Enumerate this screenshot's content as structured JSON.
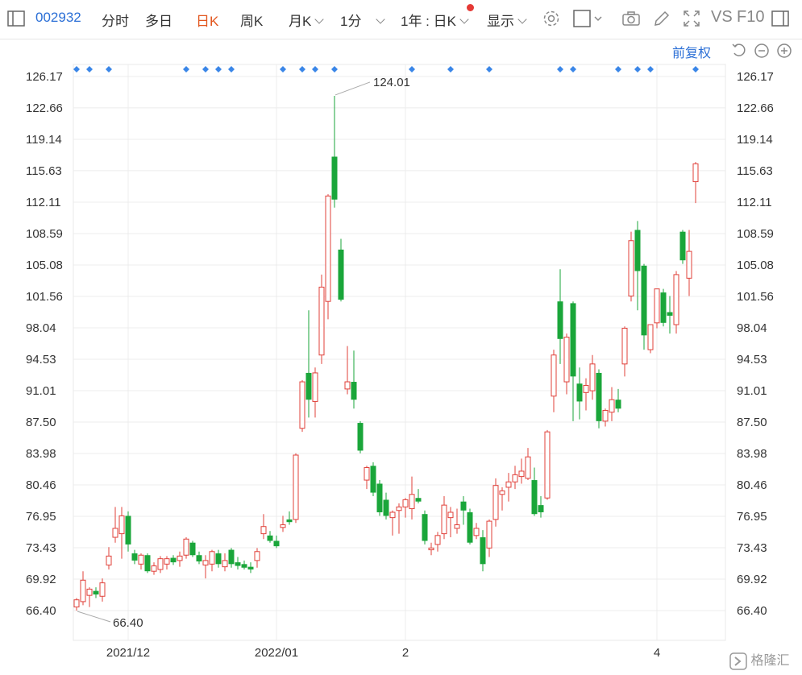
{
  "toolbar": {
    "code": "002932",
    "tabs": [
      "分时",
      "多日",
      "日K",
      "周K",
      "月K",
      "1分",
      "1年 : 日K",
      "显示"
    ],
    "active_tab": "日K",
    "vs_label": "VS",
    "f10_label": "F10",
    "adjust_label": "前复权"
  },
  "colors": {
    "up": "#e0403a",
    "down": "#1aa63a",
    "marker": "#3a86e8",
    "accent": "#2b6fd6"
  },
  "watermark": "格隆汇",
  "chart_data": {
    "type": "candlestick",
    "y_ticks": [
      "126.17",
      "122.66",
      "119.14",
      "115.63",
      "112.11",
      "108.59",
      "105.08",
      "101.56",
      "98.04",
      "94.53",
      "91.01",
      "87.50",
      "83.98",
      "80.46",
      "76.95",
      "73.43",
      "69.92",
      "66.40"
    ],
    "ylim": [
      66.4,
      126.17
    ],
    "x_labels": [
      {
        "label": "2021/12",
        "index": 8
      },
      {
        "label": "2022/01",
        "index": 31
      },
      {
        "label": "2",
        "index": 51
      },
      {
        "label": "4",
        "index": 90
      }
    ],
    "annotations": [
      {
        "label": "124.01",
        "index": 40,
        "value": 124.01
      },
      {
        "label": "66.40",
        "index": 0,
        "value": 66.4
      }
    ],
    "marker_indices": [
      0,
      2,
      5,
      17,
      20,
      22,
      24,
      32,
      35,
      37,
      40,
      52,
      58,
      64,
      75,
      77,
      84,
      87,
      89,
      96
    ],
    "candles": [
      {
        "o": 66.8,
        "h": 67.8,
        "l": 66.4,
        "c": 67.6
      },
      {
        "o": 67.4,
        "h": 70.8,
        "l": 67.0,
        "c": 69.8
      },
      {
        "o": 68.1,
        "h": 69.0,
        "l": 66.8,
        "c": 68.8
      },
      {
        "o": 68.6,
        "h": 69.0,
        "l": 67.8,
        "c": 68.2
      },
      {
        "o": 68.0,
        "h": 70.0,
        "l": 67.4,
        "c": 69.5
      },
      {
        "o": 71.5,
        "h": 73.5,
        "l": 71.0,
        "c": 72.5
      },
      {
        "o": 74.6,
        "h": 78.0,
        "l": 74.0,
        "c": 75.6
      },
      {
        "o": 75.0,
        "h": 78.0,
        "l": 72.2,
        "c": 77.0
      },
      {
        "o": 77.0,
        "h": 77.5,
        "l": 73.0,
        "c": 73.8
      },
      {
        "o": 72.8,
        "h": 73.2,
        "l": 71.6,
        "c": 72.0
      },
      {
        "o": 71.6,
        "h": 72.8,
        "l": 71.0,
        "c": 72.6
      },
      {
        "o": 72.6,
        "h": 72.8,
        "l": 70.6,
        "c": 70.8
      },
      {
        "o": 70.8,
        "h": 71.8,
        "l": 70.4,
        "c": 71.4
      },
      {
        "o": 71.0,
        "h": 72.5,
        "l": 70.6,
        "c": 72.2
      },
      {
        "o": 71.6,
        "h": 72.5,
        "l": 71.0,
        "c": 72.2
      },
      {
        "o": 72.3,
        "h": 72.6,
        "l": 71.5,
        "c": 71.8
      },
      {
        "o": 72.0,
        "h": 73.0,
        "l": 71.3,
        "c": 72.5
      },
      {
        "o": 72.6,
        "h": 74.6,
        "l": 72.2,
        "c": 74.4
      },
      {
        "o": 74.0,
        "h": 74.2,
        "l": 72.4,
        "c": 72.6
      },
      {
        "o": 72.6,
        "h": 73.0,
        "l": 71.6,
        "c": 71.9
      },
      {
        "o": 71.5,
        "h": 72.6,
        "l": 70.0,
        "c": 72.0
      },
      {
        "o": 71.6,
        "h": 73.2,
        "l": 70.8,
        "c": 73.0
      },
      {
        "o": 72.8,
        "h": 73.2,
        "l": 71.2,
        "c": 71.6
      },
      {
        "o": 71.3,
        "h": 72.8,
        "l": 70.8,
        "c": 72.0
      },
      {
        "o": 73.2,
        "h": 73.4,
        "l": 71.2,
        "c": 71.6
      },
      {
        "o": 71.8,
        "h": 72.4,
        "l": 71.0,
        "c": 71.4
      },
      {
        "o": 71.6,
        "h": 72.0,
        "l": 71.0,
        "c": 71.2
      },
      {
        "o": 71.3,
        "h": 71.8,
        "l": 70.6,
        "c": 71.0
      },
      {
        "o": 72.0,
        "h": 73.4,
        "l": 71.2,
        "c": 73.0
      },
      {
        "o": 75.0,
        "h": 77.2,
        "l": 74.4,
        "c": 75.8
      },
      {
        "o": 74.8,
        "h": 75.3,
        "l": 74.0,
        "c": 74.2
      },
      {
        "o": 74.2,
        "h": 74.8,
        "l": 73.4,
        "c": 73.6
      },
      {
        "o": 75.7,
        "h": 77.0,
        "l": 75.2,
        "c": 76.0
      },
      {
        "o": 76.6,
        "h": 77.5,
        "l": 76.0,
        "c": 76.3
      },
      {
        "o": 76.6,
        "h": 84.0,
        "l": 76.2,
        "c": 83.8
      },
      {
        "o": 86.8,
        "h": 92.2,
        "l": 86.4,
        "c": 92.0
      },
      {
        "o": 93.0,
        "h": 100.0,
        "l": 88.0,
        "c": 90.0
      },
      {
        "o": 89.8,
        "h": 93.6,
        "l": 88.0,
        "c": 93.0
      },
      {
        "o": 95.0,
        "h": 104.0,
        "l": 94.0,
        "c": 102.6
      },
      {
        "o": 101.0,
        "h": 113.0,
        "l": 99.0,
        "c": 112.8
      },
      {
        "o": 117.2,
        "h": 124.01,
        "l": 111.5,
        "c": 112.4
      },
      {
        "o": 106.8,
        "h": 108.0,
        "l": 101.0,
        "c": 101.2
      },
      {
        "o": 91.2,
        "h": 96.0,
        "l": 90.6,
        "c": 92.0
      },
      {
        "o": 92.0,
        "h": 95.5,
        "l": 89.0,
        "c": 90.0
      },
      {
        "o": 87.4,
        "h": 87.6,
        "l": 84.0,
        "c": 84.3
      },
      {
        "o": 81.0,
        "h": 82.6,
        "l": 80.0,
        "c": 82.4
      },
      {
        "o": 82.6,
        "h": 83.0,
        "l": 79.2,
        "c": 79.6
      },
      {
        "o": 80.6,
        "h": 81.0,
        "l": 77.0,
        "c": 77.4
      },
      {
        "o": 78.8,
        "h": 79.6,
        "l": 76.6,
        "c": 77.0
      },
      {
        "o": 76.8,
        "h": 77.6,
        "l": 74.8,
        "c": 77.4
      },
      {
        "o": 77.6,
        "h": 78.4,
        "l": 75.0,
        "c": 78.0
      },
      {
        "o": 78.0,
        "h": 79.0,
        "l": 76.8,
        "c": 78.8
      },
      {
        "o": 77.8,
        "h": 81.4,
        "l": 76.6,
        "c": 79.4
      },
      {
        "o": 79.0,
        "h": 80.0,
        "l": 78.4,
        "c": 78.6
      },
      {
        "o": 77.2,
        "h": 77.6,
        "l": 73.8,
        "c": 74.2
      },
      {
        "o": 73.2,
        "h": 74.0,
        "l": 72.6,
        "c": 73.4
      },
      {
        "o": 73.8,
        "h": 75.2,
        "l": 73.0,
        "c": 74.8
      },
      {
        "o": 75.0,
        "h": 79.2,
        "l": 74.4,
        "c": 78.2
      },
      {
        "o": 76.8,
        "h": 78.0,
        "l": 74.6,
        "c": 77.4
      },
      {
        "o": 75.6,
        "h": 77.8,
        "l": 75.0,
        "c": 76.0
      },
      {
        "o": 78.6,
        "h": 79.2,
        "l": 76.0,
        "c": 77.6
      },
      {
        "o": 77.4,
        "h": 77.8,
        "l": 73.8,
        "c": 74.0
      },
      {
        "o": 74.8,
        "h": 76.2,
        "l": 74.4,
        "c": 75.6
      },
      {
        "o": 74.6,
        "h": 75.4,
        "l": 70.8,
        "c": 71.6
      },
      {
        "o": 73.4,
        "h": 76.6,
        "l": 72.4,
        "c": 76.4
      },
      {
        "o": 76.6,
        "h": 81.2,
        "l": 75.8,
        "c": 80.4
      },
      {
        "o": 79.4,
        "h": 80.2,
        "l": 77.6,
        "c": 79.8
      },
      {
        "o": 80.2,
        "h": 81.8,
        "l": 78.6,
        "c": 80.8
      },
      {
        "o": 80.8,
        "h": 82.6,
        "l": 80.0,
        "c": 81.6
      },
      {
        "o": 81.4,
        "h": 83.4,
        "l": 80.6,
        "c": 82.0
      },
      {
        "o": 81.2,
        "h": 84.6,
        "l": 81.0,
        "c": 83.6
      },
      {
        "o": 81.0,
        "h": 82.4,
        "l": 77.0,
        "c": 77.2
      },
      {
        "o": 78.2,
        "h": 79.2,
        "l": 76.8,
        "c": 77.4
      },
      {
        "o": 79.0,
        "h": 86.6,
        "l": 78.8,
        "c": 86.4
      },
      {
        "o": 90.4,
        "h": 95.6,
        "l": 88.6,
        "c": 95.0
      },
      {
        "o": 101.0,
        "h": 104.6,
        "l": 94.0,
        "c": 96.8
      },
      {
        "o": 92.0,
        "h": 97.4,
        "l": 90.6,
        "c": 97.0
      },
      {
        "o": 100.8,
        "h": 101.0,
        "l": 87.6,
        "c": 92.6
      },
      {
        "o": 91.8,
        "h": 93.6,
        "l": 87.8,
        "c": 89.8
      },
      {
        "o": 90.8,
        "h": 92.4,
        "l": 88.8,
        "c": 91.6
      },
      {
        "o": 91.0,
        "h": 95.0,
        "l": 90.0,
        "c": 94.0
      },
      {
        "o": 93.0,
        "h": 93.4,
        "l": 86.8,
        "c": 87.6
      },
      {
        "o": 87.6,
        "h": 89.0,
        "l": 87.0,
        "c": 88.8
      },
      {
        "o": 88.6,
        "h": 91.4,
        "l": 87.6,
        "c": 90.0
      },
      {
        "o": 90.0,
        "h": 91.2,
        "l": 88.6,
        "c": 89.0
      },
      {
        "o": 94.0,
        "h": 98.2,
        "l": 92.6,
        "c": 98.0
      },
      {
        "o": 101.6,
        "h": 108.8,
        "l": 101.0,
        "c": 107.8
      },
      {
        "o": 109.0,
        "h": 110.0,
        "l": 100.0,
        "c": 104.4
      },
      {
        "o": 105.0,
        "h": 105.2,
        "l": 95.6,
        "c": 97.2
      },
      {
        "o": 95.6,
        "h": 98.4,
        "l": 95.2,
        "c": 98.4
      },
      {
        "o": 98.6,
        "h": 102.4,
        "l": 98.0,
        "c": 102.4
      },
      {
        "o": 102.0,
        "h": 102.4,
        "l": 98.2,
        "c": 98.6
      },
      {
        "o": 99.8,
        "h": 101.6,
        "l": 97.4,
        "c": 99.4
      },
      {
        "o": 98.4,
        "h": 104.4,
        "l": 97.4,
        "c": 104.0
      },
      {
        "o": 108.8,
        "h": 109.0,
        "l": 105.2,
        "c": 105.6
      },
      {
        "o": 103.6,
        "h": 109.0,
        "l": 101.6,
        "c": 106.6
      },
      {
        "o": 114.4,
        "h": 116.6,
        "l": 112.0,
        "c": 116.4
      }
    ]
  }
}
